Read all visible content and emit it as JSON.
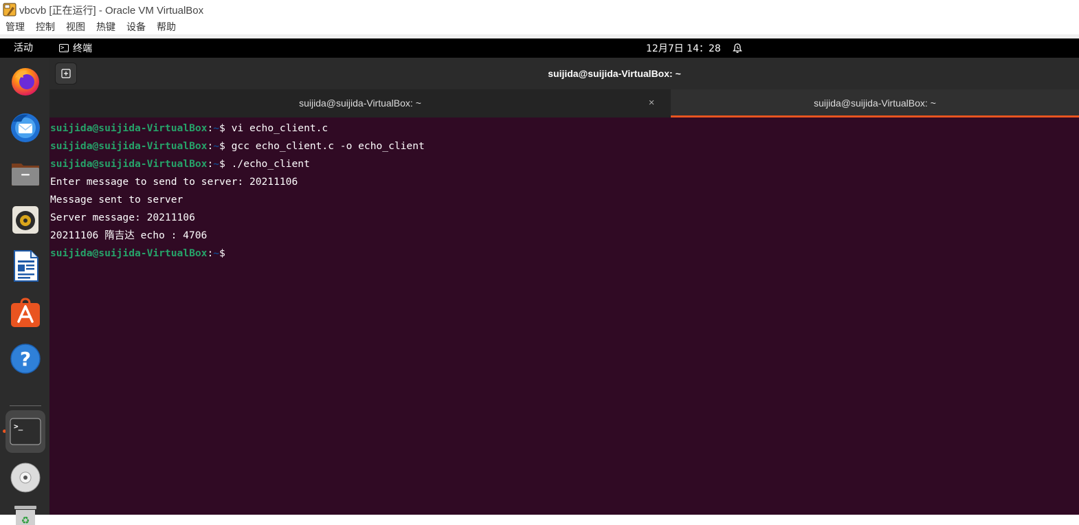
{
  "vbox": {
    "title": "vbcvb [正在运行] - Oracle VM VirtualBox",
    "menu": [
      "管理",
      "控制",
      "视图",
      "热键",
      "设备",
      "帮助"
    ]
  },
  "topbar": {
    "activities": "活动",
    "app_name": "终端",
    "app_icon_glyph": ">_",
    "clock": "12月7日  14：28",
    "icons": [
      "terminal-icon",
      "alarm-icon"
    ]
  },
  "dock": {
    "items": [
      "firefox-icon",
      "thunderbird-icon",
      "files-icon",
      "rhythmbox-icon",
      "libreoffice-writer-icon",
      "app-center-icon",
      "help-icon",
      "terminal-icon",
      "dvd-icon",
      "trash-icon"
    ],
    "active_item": "terminal-icon"
  },
  "terminal": {
    "window_title": "suijida@suijida-VirtualBox: ~",
    "tabs": [
      {
        "label": "suijida@suijida-VirtualBox: ~",
        "active": false
      },
      {
        "label": "suijida@suijida-VirtualBox: ~",
        "active": true
      }
    ],
    "tab_close_glyph": "×",
    "prompt": {
      "user_host": "suijida@suijida-VirtualBox",
      "colon": ":",
      "path": "~",
      "symbol": "$"
    },
    "lines": [
      {
        "type": "prompt",
        "command": " vi echo_client.c"
      },
      {
        "type": "prompt",
        "command": " gcc echo_client.c -o echo_client"
      },
      {
        "type": "prompt",
        "command": " ./echo_client"
      },
      {
        "type": "output",
        "text": "Enter message to send to server: 20211106"
      },
      {
        "type": "output",
        "text": "Message sent to server"
      },
      {
        "type": "output",
        "text": "Server message: 20211106"
      },
      {
        "type": "output",
        "text": "20211106 隋吉达 echo : 4706"
      },
      {
        "type": "prompt",
        "command": ""
      }
    ]
  },
  "colors": {
    "terminal_bg": "#300a24",
    "prompt_green": "#26a269",
    "prompt_blue": "#12488b",
    "accent_orange": "#e95420",
    "dock_bg": "#2c2c2c"
  }
}
